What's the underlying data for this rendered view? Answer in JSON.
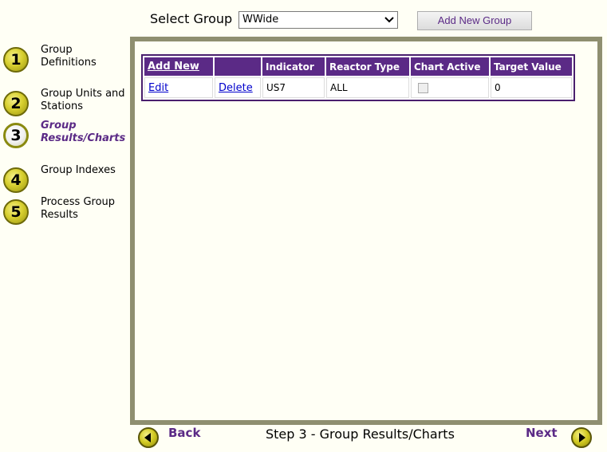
{
  "header": {
    "select_label": "Select Group",
    "selected_group": "WWide",
    "add_group_button": "Add New Group"
  },
  "steps": [
    {
      "number": "1",
      "label": "Group Definitions",
      "active": false
    },
    {
      "number": "2",
      "label": "Group Units and Stations",
      "active": false
    },
    {
      "number": "3",
      "label": "Group Results/Charts",
      "active": true
    },
    {
      "number": "4",
      "label": "Group Indexes",
      "active": false
    },
    {
      "number": "5",
      "label": "Process Group Results",
      "active": false
    }
  ],
  "grid": {
    "headers": [
      "Add New",
      "",
      "Indicator",
      "Reactor Type",
      "Chart Active",
      "Target Value"
    ],
    "rows": [
      {
        "edit": "Edit",
        "delete": "Delete",
        "indicator": "US7",
        "reactor_type": "ALL",
        "chart_active": false,
        "target_value": "0"
      }
    ]
  },
  "footer": {
    "back_label": "Back",
    "caption": "Step 3 - Group Results/Charts",
    "next_label": "Next"
  },
  "colors": {
    "accent_purple": "#5b2a86",
    "panel_border": "#8f8f70",
    "background": "#fffff5"
  }
}
